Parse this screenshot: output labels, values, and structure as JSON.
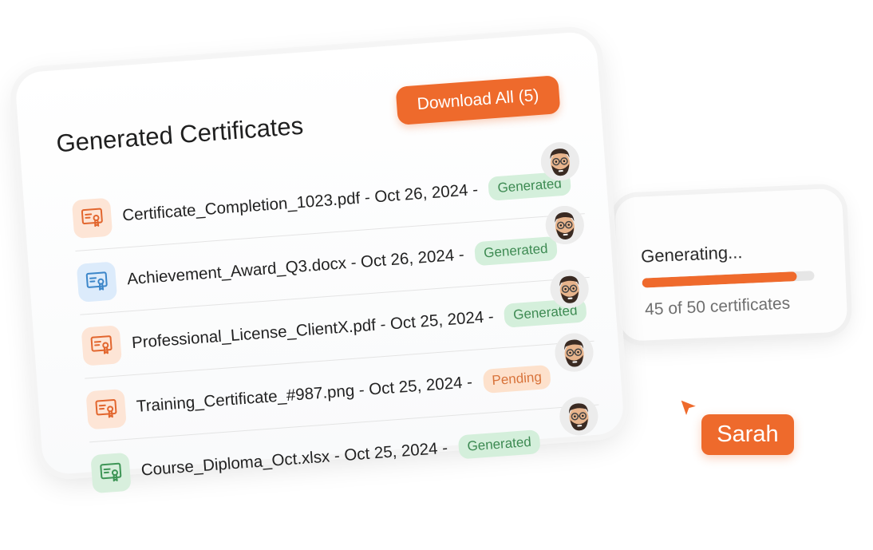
{
  "card": {
    "title": "Generated Certificates",
    "download_all_label": "Download All (5)"
  },
  "certificates": [
    {
      "filename": "Certificate_Completion_1023.pdf",
      "meta": " - Oct 26, 2024 - ",
      "status": "Generated",
      "icon": "certificate-icon",
      "icon_color": "orange"
    },
    {
      "filename": "Achievement_Award_Q3.docx",
      "meta": " - Oct 26, 2024 - ",
      "status": "Generated",
      "icon": "certificate-icon",
      "icon_color": "blue"
    },
    {
      "filename": "Professional_License_ClientX.pdf",
      "meta": " - Oct 25, 2024 - ",
      "status": "Generated",
      "icon": "certificate-icon",
      "icon_color": "orange"
    },
    {
      "filename": "Training_Certificate_#987.png",
      "meta": " - Oct 25, 2024 - ",
      "status": "Pending",
      "icon": "certificate-icon",
      "icon_color": "orange"
    },
    {
      "filename": "Course_Diploma_Oct.xlsx",
      "meta": " - Oct 25, 2024 - ",
      "status": "Generated",
      "icon": "certificate-icon",
      "icon_color": "green"
    }
  ],
  "progress": {
    "title": "Generating...",
    "completed": 45,
    "total": 50,
    "count_label": "45 of 50 certificates",
    "fraction": 0.9
  },
  "collaborator": {
    "name": "Sarah",
    "cursor_icon": "pointer-cursor-icon"
  },
  "colors": {
    "accent": "#ee6a2c",
    "generated_bg": "#d4efdb",
    "generated_text": "#3d8a52",
    "pending_bg": "#fde1cc",
    "pending_text": "#d8733a"
  }
}
